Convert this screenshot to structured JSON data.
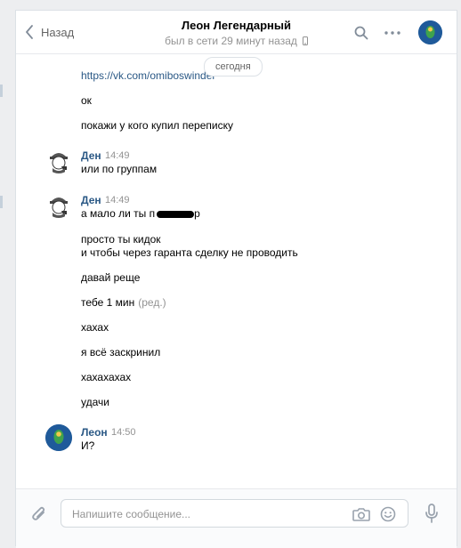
{
  "header": {
    "back_label": "Назад",
    "title": "Леон Легендарный",
    "status": "был в сети 29 минут назад"
  },
  "chat": {
    "date_label": "сегодня",
    "top_messages": [
      "https://vk.com/omiboswinder",
      "ок",
      "покажи у кого купил переписку"
    ],
    "group1": {
      "author": "Ден",
      "time": "14:49",
      "text": "или по группам"
    },
    "group2": {
      "author": "Ден",
      "time": "14:49",
      "first_text": "а мало ли ты п",
      "first_text_tail": "р",
      "lines": [
        "просто ты кидок",
        "и чтобы через гаранта сделку не проводить",
        "давай реще",
        "тебе 1 мин",
        "хахах",
        "я всё заскринил",
        "хахахахах",
        "удачи"
      ],
      "edited_label": "(ред.)"
    },
    "group3": {
      "author": "Леон",
      "time": "14:50",
      "text": "И?"
    }
  },
  "composer": {
    "placeholder": "Напишите сообщение..."
  },
  "colors": {
    "link": "#2a5885",
    "avatar_bg": "#1f5a9a",
    "muted": "#939393"
  }
}
